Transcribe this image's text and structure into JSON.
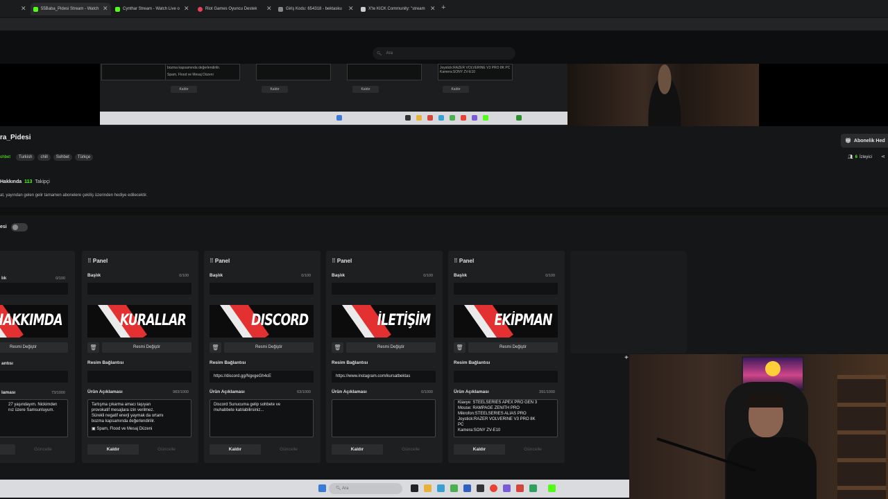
{
  "browser": {
    "tabs": [
      {
        "title": "55Baba_Pidesi Stream - Watch",
        "favicon_color": "#53fc18",
        "active": true
      },
      {
        "title": "Cynthar Stream - Watch Live o",
        "favicon_color": "#53fc18",
        "active": false
      },
      {
        "title": "Riot Games Oyuncu Destek",
        "favicon_color": "#e84057",
        "active": false
      },
      {
        "title": "Giriş Kodu: 654318 - bektasku",
        "favicon_color": "#888888",
        "active": false
      },
      {
        "title": "X'te KICK Community: \"stream",
        "favicon_color": "#cccccc",
        "active": false
      }
    ],
    "new_tab": "+"
  },
  "site": {
    "search_placeholder": "Ara"
  },
  "inner_screen": {
    "panel_text_1": "bozma kapsamında değerlendirilir.",
    "panel_text_2": "Spam, Flood ve Mesaj Düzeni",
    "panel_text_3": "Joystick:RAZER VOLVERINE V3 PRO 8K PC",
    "panel_text_4": "Kamera:SONY ZV-E10",
    "remove_label": "Kaldır",
    "update_label": "Güncelle"
  },
  "channel": {
    "name": "ra_Pidesi",
    "tags": [
      "ohbet",
      "Turkish",
      "chill",
      "Sohbet",
      "Türkçe"
    ],
    "subscribe_label": "Abonelik Hed",
    "viewers_count": "6",
    "viewers_label": "İzleyici",
    "about_title": "Hakkında",
    "followers_count": "113",
    "followers_label": "Takipçi",
    "about_description": "at, yayından gelen gelir tamamen abonelere çekiliş üzerinden hediye edilecektir."
  },
  "editor": {
    "label": "esi"
  },
  "labels": {
    "panel": "Panel",
    "title": "Başlık",
    "change_image": "Resmi Değiştir",
    "image_link": "Resim Bağlantısı",
    "product_description": "Ürün Açıklaması",
    "remove": "Kaldır",
    "update": "Güncelle",
    "title_short": "lık",
    "image_link_short": "antısı",
    "product_description_short": "laması"
  },
  "panels": [
    {
      "banner_text": "HAKKIMDA",
      "title_count": "0/100",
      "image_link": "",
      "desc_count": "73/1000",
      "description_lines": [
        "27 yaşındayım. Nickimden",
        "nız üzere Samsunluyum."
      ]
    },
    {
      "banner_text": "KURALLAR",
      "title_count": "0/100",
      "image_link": "",
      "desc_count": "983/1000",
      "description_lines": [
        "Tartışma çıkarma amacı taşıyan",
        "provokatif mesajlara izin verilmez.",
        "Sürekli negatif enerji yaymak da ortamı",
        "bozma kapsamında değerlendirilir.",
        "",
        "▣ Spam, Flood ve Mesaj Düzeni"
      ]
    },
    {
      "banner_text": "DISCORD",
      "title_count": "0/100",
      "image_link": "https://discord.gg/NgxgeGh4cE",
      "desc_count": "63/1000",
      "description_lines": [
        "Discord Sunucuma gelip sohbete ve",
        "muhabbete katılabilirsiniz..."
      ]
    },
    {
      "banner_text": "İLETİŞİM",
      "title_count": "0/100",
      "image_link": "https://www.instagram.com/kursatbektas",
      "desc_count": "0/1000",
      "description_lines": []
    },
    {
      "banner_text": "EKİPMAN",
      "title_count": "0/100",
      "image_link": "",
      "desc_count": "391/1000",
      "description_lines": [
        "Klavye: STEELSERIES APEX PRO GEN 3",
        "Mouse: RAMPAGE ZENITH PRO",
        "Mikrofon:STEELSERIES ALIAS PRO",
        "Joystick:RAZER VOLVERINE V3 PRO 8K",
        "PC",
        "Kamera:SONY ZV-E10"
      ]
    }
  ],
  "taskbar": {
    "search_placeholder": "Ara"
  },
  "icons": {
    "grip": "drag-handle-icon",
    "trash": "trash-icon",
    "search": "search-icon",
    "gift": "gift-icon",
    "viewers": "viewers-icon",
    "share": "share-icon"
  },
  "colors": {
    "accent": "#53fc18",
    "banner_red": "#e33030"
  }
}
